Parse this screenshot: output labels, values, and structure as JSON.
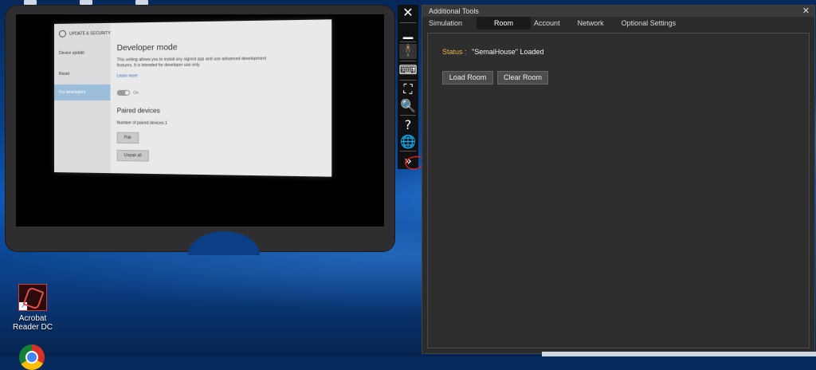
{
  "desktop": {
    "icons": [
      {
        "label": "Acrobat Reader DC",
        "icon": "acrobat-reader-icon"
      },
      {
        "label": "",
        "icon": "chrome-icon"
      }
    ]
  },
  "viewer": {
    "settings": {
      "header": "UPDATE & SECURITY",
      "side_items": [
        "Device update",
        "Reset",
        "For developers"
      ],
      "title": "Developer mode",
      "description": "This setting allows you to install any signed app and use advanced development features. It is intended for developer use only.",
      "learn_more": "Learn more",
      "toggle_state": "On",
      "paired_title": "Paired devices",
      "paired_count": "Number of paired devices:1",
      "pair_button": "Pair",
      "unpair_button": "Unpair all"
    }
  },
  "toolbar": {
    "items": [
      {
        "icon": "close-icon",
        "glyph": "✕"
      },
      {
        "icon": "minimize-icon",
        "glyph": "▁"
      },
      {
        "icon": "person-icon",
        "glyph": "🕴"
      },
      {
        "icon": "keyboard-icon",
        "glyph": "⌨"
      },
      {
        "icon": "fit-view-icon",
        "glyph": "⛶"
      },
      {
        "icon": "zoom-icon",
        "glyph": "🔍"
      },
      {
        "icon": "help-icon",
        "glyph": "?"
      },
      {
        "icon": "globe-icon",
        "glyph": "🌐"
      },
      {
        "icon": "expand-icon",
        "glyph": "»"
      }
    ]
  },
  "panel": {
    "title": "Additional Tools",
    "tabs": [
      "Simulation",
      "Room",
      "Account",
      "Network",
      "Optional Settings"
    ],
    "active_tab": "Room",
    "status_label": "Status :",
    "status_value": "\"SemaiHouse\" Loaded",
    "load_button": "Load Room",
    "clear_button": "Clear Room"
  },
  "colors": {
    "status_label": "#e7b24c",
    "panel_bg": "#2b2b2b",
    "annotation": "#e02020"
  }
}
